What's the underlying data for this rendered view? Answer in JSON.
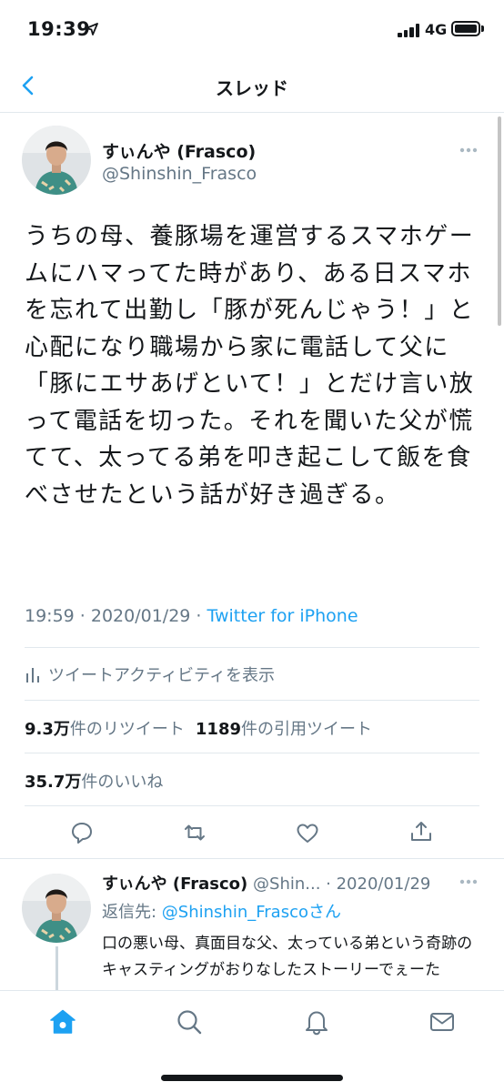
{
  "status_bar": {
    "time": "19:39",
    "network": "4G",
    "icons": [
      "location-arrow-icon",
      "signal-bars-icon",
      "battery-icon"
    ]
  },
  "header": {
    "title": "スレッド",
    "back_icon": "chevron-left-icon"
  },
  "main_tweet": {
    "author_name": "すぃんや (Frasco)",
    "author_handle": "@Shinshin_Frasco",
    "text": "うちの母、養豚場を運営するスマホゲームにハマってた時があり、ある日スマホを忘れて出勤し「豚が死んじゃう！」と心配になり職場から家に電話して父に「豚にエサあげといて！」とだけ言い放って電話を切った。それを聞いた父が慌てて、太ってる弟を叩き起こして飯を食べさせたという話が好き過ぎる。",
    "timestamp": "19:59 · 2020/01/29 · ",
    "source": "Twitter for iPhone",
    "activity_label": "ツイートアクティビティを表示",
    "retweet_count": "9.3万",
    "retweet_label": "件のリツイート",
    "quote_count": "1189",
    "quote_label": "件の引用ツイート",
    "like_count": "35.7万",
    "like_label": "件のいいね"
  },
  "reply": {
    "author_name": "すぃんや (Frasco)",
    "author_handle": "@Shin...",
    "time": " · 2020/01/29",
    "replying_to_prefix": "返信先: ",
    "replying_to": "@Shinshin_Frasco",
    "replying_to_suffix": "さん",
    "text": "口の悪い母、真面目な父、太っている弟という奇跡のキャスティングがおりなしたストーリーでぇーた"
  },
  "tab_bar": {
    "items": [
      "home-icon",
      "search-icon",
      "notifications-icon",
      "messages-icon"
    ],
    "active": "home-icon"
  },
  "colors": {
    "accent": "#1da1f2",
    "secondary_text": "#657786",
    "primary_text": "#14171a",
    "divider": "#e1e8ed"
  }
}
